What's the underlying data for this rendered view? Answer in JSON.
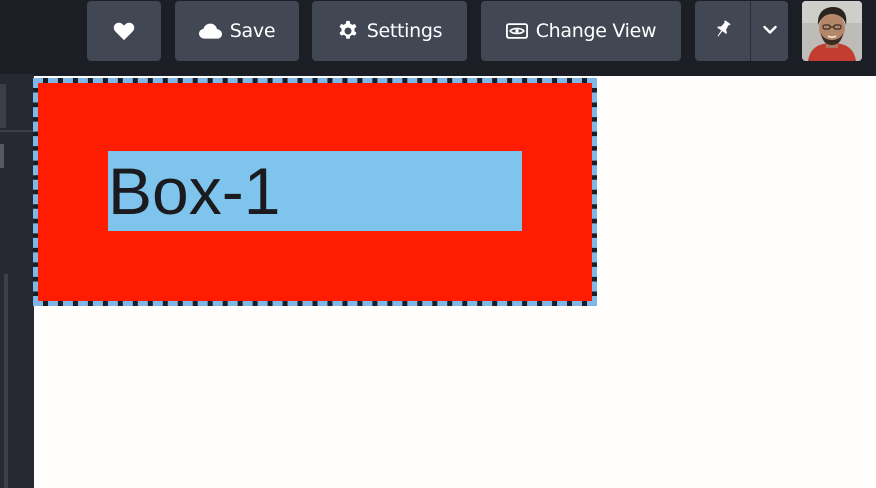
{
  "toolbar": {
    "heart_icon": "heart-icon",
    "save_label": "Save",
    "save_icon": "cloud-icon",
    "settings_label": "Settings",
    "settings_icon": "gear-icon",
    "change_view_label": "Change View",
    "change_view_icon": "eye-icon",
    "pin_icon": "pin-icon",
    "dropdown_icon": "chevron-down-icon",
    "avatar": "user-avatar"
  },
  "canvas": {
    "box": {
      "label": "Box-1",
      "background_color": "#ff1c00",
      "label_background_color": "#7ec4ed",
      "selection_border_color": "#7fb7e6",
      "selected": true
    }
  },
  "colors": {
    "toolbar_background": "#1c1e25",
    "button_background": "#424754",
    "canvas_background": "#fffefd"
  }
}
